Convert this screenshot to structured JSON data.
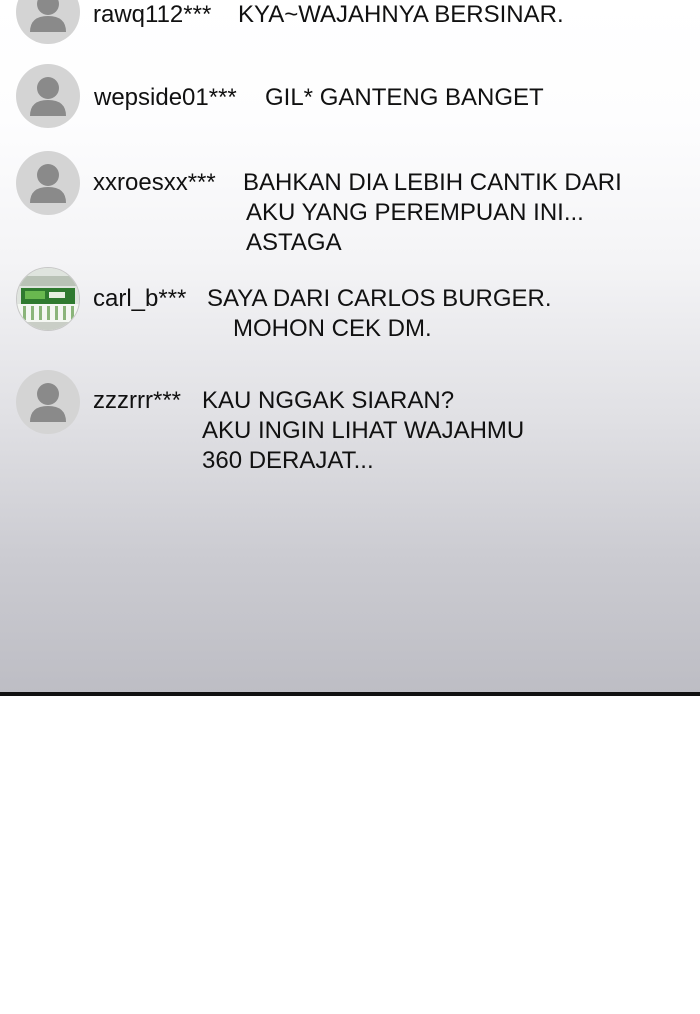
{
  "comments": [
    {
      "username": "rawq112***",
      "lines": [
        "KYA~WAJAHNYA BERSINAR."
      ],
      "avatar": "default-user-icon"
    },
    {
      "username": "wepside01***",
      "lines": [
        "GIL* GANTENG BANGET"
      ],
      "avatar": "default-user-icon"
    },
    {
      "username": "xxroesxx***",
      "lines": [
        "BAHKAN DIA LEBIH CANTIK DARI",
        "AKU YANG PEREMPUAN INI...",
        "ASTAGA"
      ],
      "avatar": "default-user-icon"
    },
    {
      "username": "carl_b***",
      "lines": [
        "SAYA DARI CARLOS BURGER.",
        "MOHON CEK DM."
      ],
      "avatar": "burger-shop-photo"
    },
    {
      "username": "zzzrrr***",
      "lines": [
        "KAU NGGAK SIARAN?",
        "AKU INGIN LIHAT WAJAHMU",
        "360 DERAJAT..."
      ],
      "avatar": "default-user-icon"
    }
  ],
  "colors": {
    "text": "#111111",
    "avatar_bg": "#d4d4d4",
    "avatar_fg": "#8a8a8a",
    "border": "#111111"
  }
}
